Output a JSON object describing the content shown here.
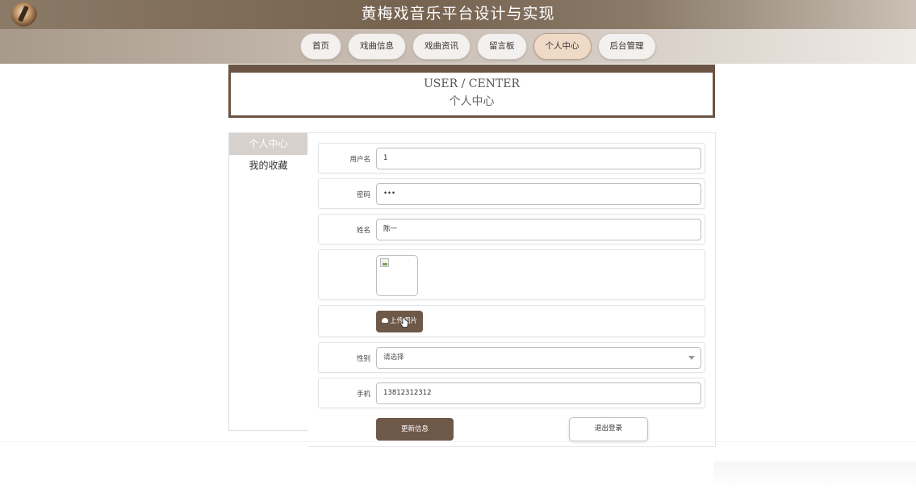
{
  "header": {
    "title": "黄梅戏音乐平台设计与实现",
    "logo": "opera-figure-logo"
  },
  "nav": {
    "items": [
      {
        "label": "首页"
      },
      {
        "label": "戏曲信息"
      },
      {
        "label": "戏曲资讯"
      },
      {
        "label": "留言板"
      },
      {
        "label": "个人中心",
        "active": true
      },
      {
        "label": "后台管理"
      }
    ]
  },
  "page_title": {
    "en": "USER / CENTER",
    "cn": "个人中心"
  },
  "sidebar": {
    "items": [
      {
        "label": "个人中心",
        "active": true
      },
      {
        "label": "我的收藏"
      }
    ]
  },
  "form": {
    "username": {
      "label": "用户名",
      "value": "1"
    },
    "password": {
      "label": "密码",
      "value": "•••"
    },
    "name": {
      "label": "姓名",
      "value": "陈一"
    },
    "avatar": {
      "icon": "broken-image-icon"
    },
    "upload": {
      "label": "上传图片",
      "icon": "cloud-upload-icon"
    },
    "gender": {
      "label": "性别",
      "placeholder": "请选择"
    },
    "phone": {
      "label": "手机",
      "value": "13812312312"
    },
    "update_button": "更新信息",
    "logout_button": "退出登录"
  },
  "colors": {
    "accent": "#6e5848",
    "header_bg": "#75624f",
    "active_tab": "#efd9c7"
  }
}
